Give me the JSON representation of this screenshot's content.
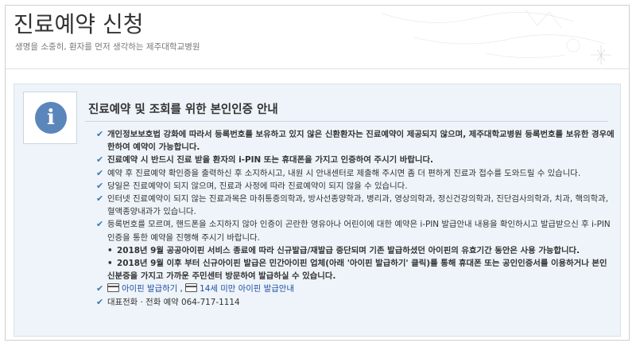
{
  "header": {
    "title": "진료예약 신청",
    "subtitle": "생명을 소중히, 환자를 먼저 생각하는 제주대학교병원"
  },
  "panel": {
    "title": "진료예약 및 조회를 위한 본인인증 안내",
    "icon": "info-icon",
    "items": [
      "개인정보보호법 강화에 따라서 등록번호를 보유하고 있지 않은 신환환자는 진료예약이 제공되지 않으며, 제주대학교병원 등록번호를 보유한 경우에 한하여 예약이 가능합니다.",
      "진료예약 시 반드시 진료 받을 환자의 i-PIN 또는 휴대폰을 가지고 인증하여 주시기 바랍니다.",
      "예약 후 진료예약 확인증을 출력하신 후 소지하시고, 내원 시 안내센터로 제출해 주시면 좀 더 편하게 진료과 접수를 도와드릴 수 있습니다.",
      "당일은 진료예약이 되지 않으며, 진료과 사정에 따라 진료예약이 되지 않을 수 있습니다.",
      "인터넷 진료예약이 되지 않는 진료과목은 마취통증의학과, 방사선종양학과, 병리과, 영상의학과, 정신건강의학과, 진단검사의학과, 치과, 핵의학과, 혈액종양내과가 있습니다.",
      "등록번호를 모르며, 핸드폰을 소지하지 않아 인증이 곤란한 영유아나 어린이에 대한 예약은 i-PIN 발급안내 내용을 확인하시고 발급받으신 후 i-PIN 인증을 통한 예약을 진행해 주시기 바랍니다."
    ],
    "notes": [
      "2018년 9월 공공아이핀 서비스 종료에 따라 신규발급/재발급 중단되며 기존 발급하셨던 아이핀의 유효기간 동안은 사용 가능합니다.",
      "2018년 9월 이후 부터 신규아이핀 발급은 민간아이핀 업체(아래 '아이핀 발급하기' 클릭)를 통해 휴대폰 또는 공인인증서를 이용하거나 본인 신분증을 가지고 가까운 주민센터 방문하여 발급하실 수 있습니다."
    ],
    "links": {
      "ipin_issue": "아이핀 발급하기",
      "separator": ",",
      "under14_issue": "14세 미만 아이핀 발급안내"
    },
    "phone": "대표전화 · 전화 예약 064-717-1114"
  }
}
